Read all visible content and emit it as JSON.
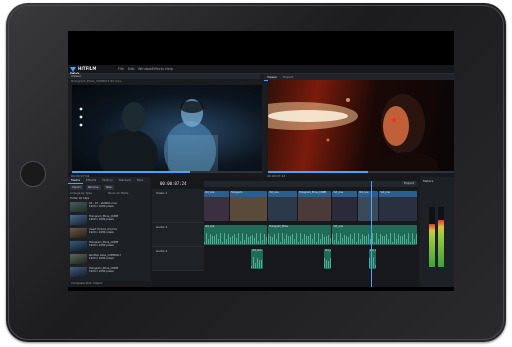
{
  "app": {
    "title": "HITFILM PRO",
    "menus": [
      "File",
      "Edit",
      "Window",
      "Effects",
      "Help"
    ]
  },
  "source_viewer": {
    "header": "Viewer",
    "clip_name": "Hologram_Elina_COMP.07-9d.mov",
    "footer": "00:00:07:04",
    "seek_position": 0.62
  },
  "program_viewer": {
    "tabs": [
      "Viewer",
      "Export"
    ],
    "footer": "00:00:07:23",
    "seek_position": 0.54
  },
  "media_panel": {
    "tabs": [
      "Media",
      "Effects",
      "History",
      "Markers",
      "Text"
    ],
    "buttons": [
      "Import",
      "Remove",
      "New"
    ],
    "arrange_label": "Arrange by: Type",
    "show_label": "Show: All Media",
    "folder_label": "Folder All Clips",
    "items": [
      {
        "name": "01 - 07 - ab0001.mov",
        "meta": "1920 x 1080 pixels"
      },
      {
        "name": "Hologram_Elina_COMP",
        "meta": "1920 x 1080 pixels"
      },
      {
        "name": "Insert Picture (2).mov",
        "meta": "1920 x 1080 pixels"
      },
      {
        "name": "Hologram_Elina_COMP",
        "meta": "1920 x 1080 pixels"
      },
      {
        "name": "Rooftop Glow_COMP09-7",
        "meta": "1920 x 1080 pixels"
      },
      {
        "name": "Hologram_Elina_COMP",
        "meta": "1920 x 1080 pixels"
      }
    ],
    "dock": [
      "Composite Shot",
      "Project"
    ]
  },
  "editor": {
    "timecode": "00:00:07:24",
    "export_label": "Export",
    "tracks": [
      {
        "name": "Video 1",
        "type": "video"
      },
      {
        "name": "Audio 1",
        "type": "audio"
      },
      {
        "name": "Audio 2",
        "type": "audio"
      }
    ],
    "video_clips": [
      {
        "label": "Vid_one",
        "start": 0.0,
        "end": 0.12
      },
      {
        "label": "Hologram",
        "start": 0.12,
        "end": 0.3
      },
      {
        "label": "Vid_one",
        "start": 0.3,
        "end": 0.44
      },
      {
        "label": "Hologram_Elina_COMP",
        "start": 0.44,
        "end": 0.6
      },
      {
        "label": "Vid_one",
        "start": 0.6,
        "end": 0.72
      },
      {
        "label": "Vid_one",
        "start": 0.72,
        "end": 0.82
      },
      {
        "label": "Vid_one",
        "start": 0.82,
        "end": 1.0
      }
    ],
    "audio1_clips": [
      {
        "label": "Vid_one",
        "start": 0.0,
        "end": 0.3
      },
      {
        "label": "Hologram_Elina",
        "start": 0.3,
        "end": 0.6
      },
      {
        "label": "Vid_one",
        "start": 0.6,
        "end": 1.0
      }
    ],
    "audio2_clips": [
      {
        "label": "Vid_one",
        "start": 0.22,
        "end": 0.28
      },
      {
        "label": "Vid_one",
        "start": 0.56,
        "end": 0.6
      },
      {
        "label": "Vid_one",
        "start": 0.77,
        "end": 0.81
      }
    ],
    "playhead": 0.78
  },
  "meters": {
    "levels": [
      0.72,
      0.78
    ],
    "label": "Meters"
  },
  "colors": {
    "accent": "#4aa3ff",
    "video_clip": "#2b5f8f",
    "audio_clip": "#1f6b57"
  }
}
